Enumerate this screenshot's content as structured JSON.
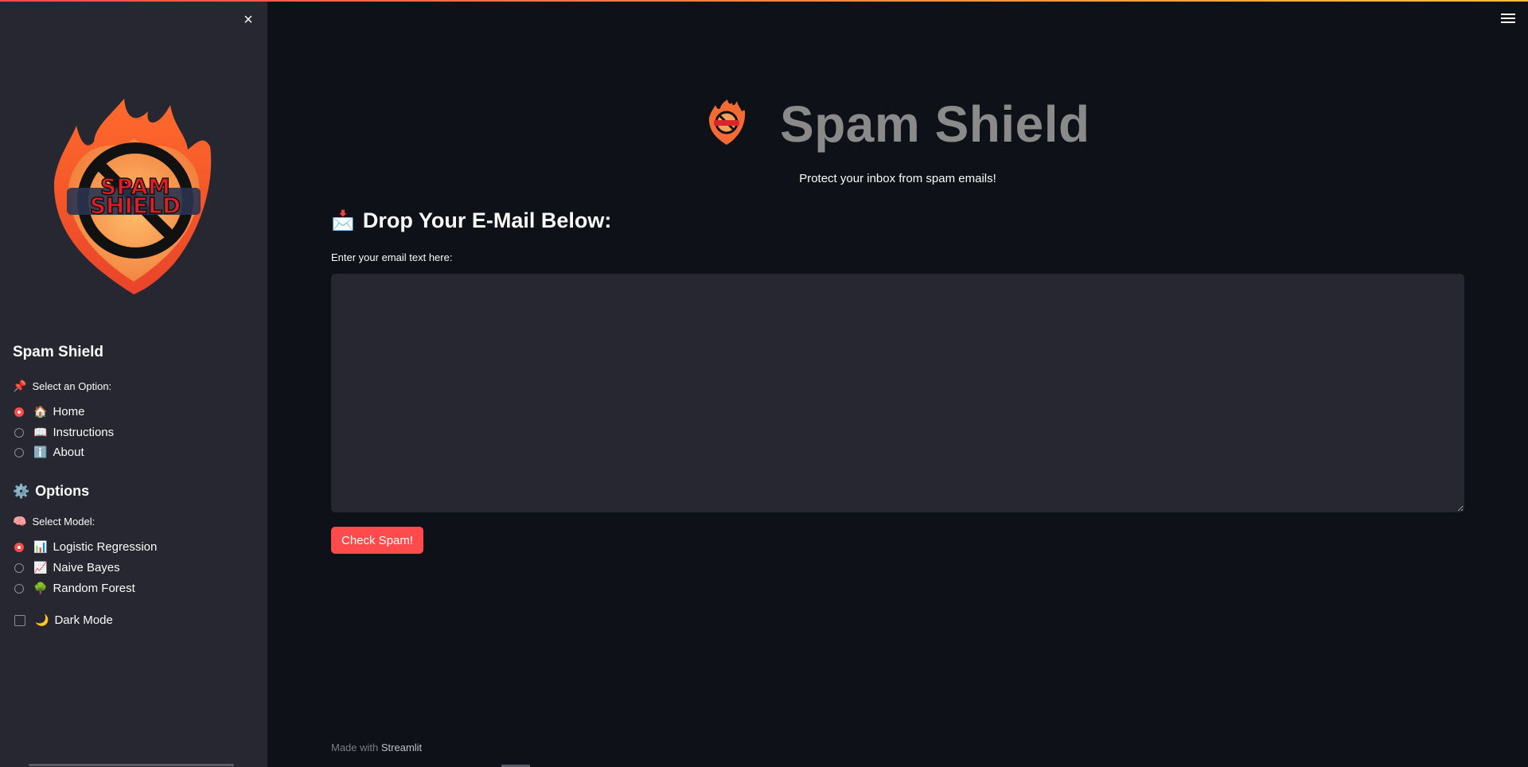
{
  "sidebar": {
    "close_icon": "×",
    "logo_text_top": "SPAM",
    "logo_text_bottom": "SHIELD",
    "title": "Spam Shield",
    "nav_label_icon": "📌",
    "nav_label": "Select an Option:",
    "nav_options": [
      {
        "icon": "🏠",
        "label": "Home",
        "selected": true
      },
      {
        "icon": "📖",
        "label": "Instructions",
        "selected": false
      },
      {
        "icon": "ℹ️",
        "label": "About",
        "selected": false
      }
    ],
    "options_icon": "⚙️",
    "options_heading": "Options",
    "model_label_icon": "🧠",
    "model_label": "Select Model:",
    "model_options": [
      {
        "icon": "📊",
        "label": "Logistic Regression",
        "selected": true
      },
      {
        "icon": "📈",
        "label": "Naive Bayes",
        "selected": false
      },
      {
        "icon": "🌳",
        "label": "Random Forest",
        "selected": false
      }
    ],
    "dark_mode_icon": "🌙",
    "dark_mode_label": "Dark Mode",
    "dark_mode_checked": false
  },
  "main": {
    "title": "Spam Shield",
    "subtitle": "Protect your inbox from spam emails!",
    "section_icon": "📩",
    "section_heading": "Drop Your E-Mail Below:",
    "field_label": "Enter your email text here:",
    "textarea_value": "",
    "check_button": "Check Spam!",
    "footer_prefix": "Made with ",
    "footer_brand": "Streamlit"
  },
  "colors": {
    "background": "#0e1117",
    "sidebar": "#262730",
    "accent": "#ff4b4b",
    "title": "#8a8a8a"
  }
}
